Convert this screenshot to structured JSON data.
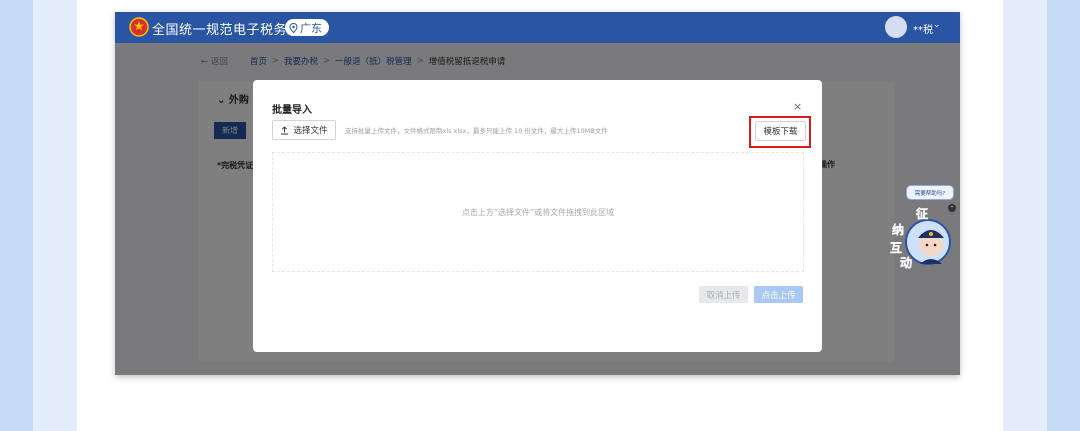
{
  "app": {
    "title": "全国统一规范电子税务局",
    "region": "广东",
    "user_name": "**税",
    "user_chevron": "⌄"
  },
  "breadcrumb": {
    "back": "← 返回",
    "items": [
      "首页",
      "我要办税",
      "一般退（抵）税管理",
      "增值税留抵退税申请"
    ],
    "separator": ">"
  },
  "background_page": {
    "section_title": "⌄  外购 2",
    "new_button": "新增",
    "column_left": "*完税凭证",
    "column_right": "操作"
  },
  "modal": {
    "title": "批量导入",
    "close": "×",
    "choose_file_label": "选择文件",
    "hint": "支持批量上传文件，文件格式限制xls xlsx，最多只能上传 10 份文件，最大上传10MB文件",
    "template_download": "模板下载",
    "dropzone_text": "点击上方“选择文件”或将文件拖拽到此区域",
    "cancel_upload": "取消上传",
    "click_upload": "点击上传"
  },
  "assistant": {
    "bubble": "需要帮助吗?",
    "characters": [
      "征",
      "纳",
      "互",
      "动"
    ]
  },
  "colors": {
    "brand": "#2a55a5",
    "highlight": "#d71c1c",
    "upload_disabled": "#a8c8f5"
  },
  "icons": {
    "emblem": "national-emblem-icon",
    "location": "location-pin-icon",
    "upload": "upload-icon",
    "close": "close-icon",
    "assistant": "assistant-avatar-icon"
  }
}
